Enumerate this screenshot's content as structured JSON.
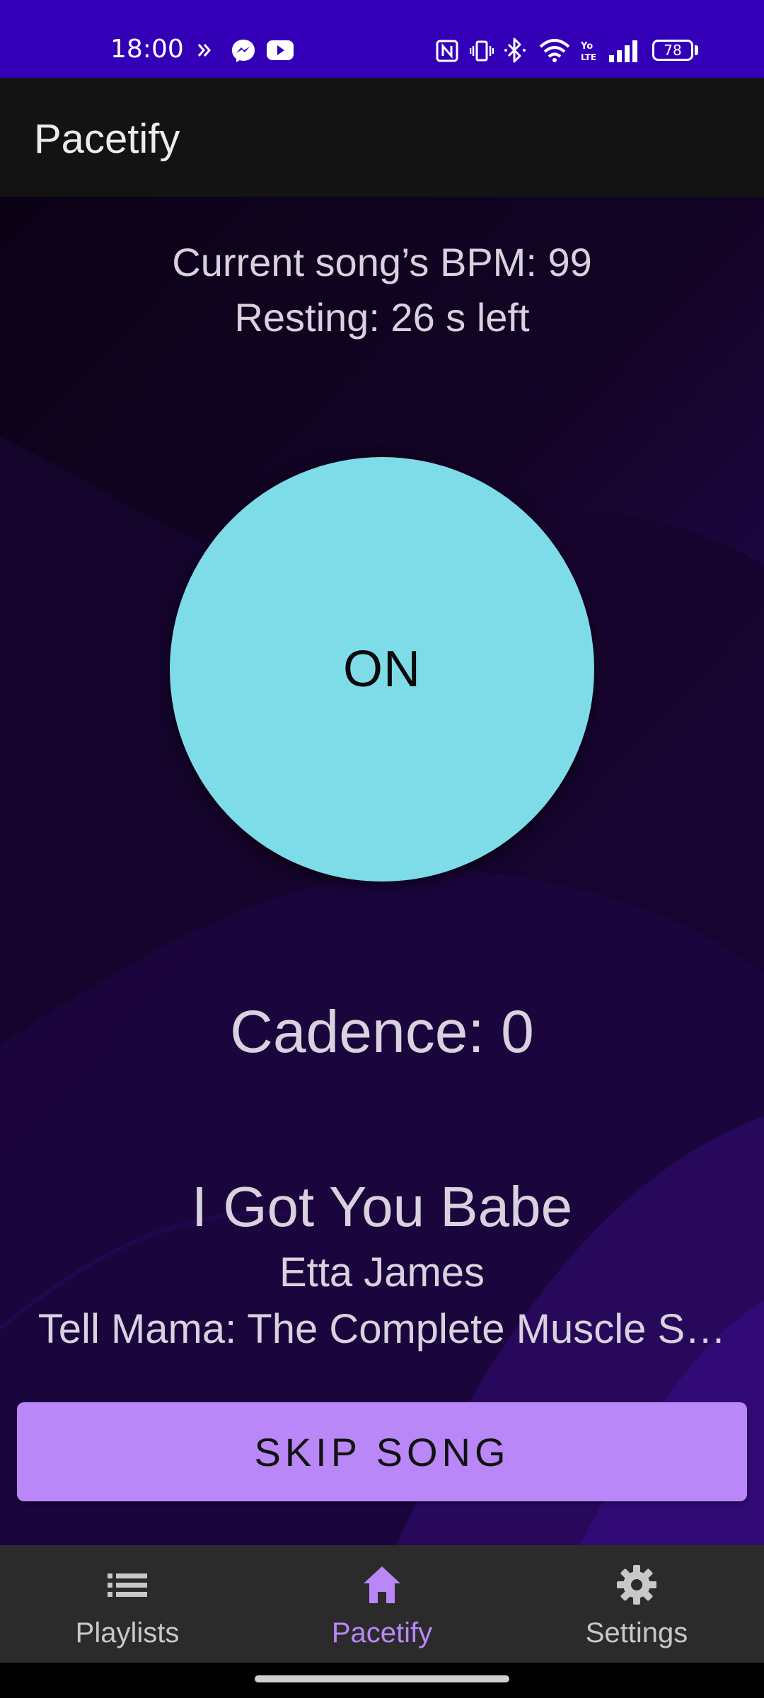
{
  "status_bar": {
    "time": "18:00",
    "battery": "78",
    "left_icons": [
      "cast-arrows-icon",
      "messenger-icon",
      "youtube-icon"
    ],
    "right_icons": [
      "nfc-icon",
      "vibrate-icon",
      "bluetooth-icon",
      "wifi-icon",
      "volte-icon",
      "signal-icon",
      "battery-icon"
    ]
  },
  "app_bar": {
    "title": "Pacetify"
  },
  "main": {
    "bpm_text": "Current song’s BPM: 99",
    "resting_text": "Resting: 26 s left",
    "toggle_label": "ON",
    "cadence_text": "Cadence: 0",
    "song": {
      "title": "I Got You Babe",
      "artist": "Etta James",
      "album": "Tell Mama: The Complete Muscle S…"
    },
    "skip_label": "SKIP SONG"
  },
  "bottom_nav": {
    "items": [
      {
        "label": "Playlists",
        "icon": "list-icon",
        "active": false
      },
      {
        "label": "Pacetify",
        "icon": "home-icon",
        "active": true
      },
      {
        "label": "Settings",
        "icon": "gear-icon",
        "active": false
      }
    ]
  },
  "colors": {
    "status_bar": "#3300b8",
    "app_bar": "#131313",
    "toggle": "#7edce8",
    "accent": "#b987f8",
    "nav_active": "#b987f8",
    "nav_inactive": "#c8c8c8",
    "nav_background": "#2b2b2b"
  }
}
